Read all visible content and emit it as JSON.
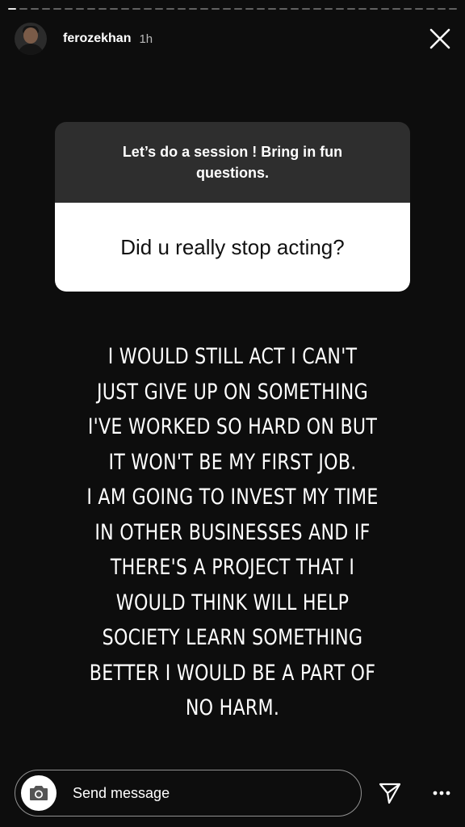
{
  "story": {
    "progress_segments": 40,
    "progress_completed": 1
  },
  "header": {
    "username": "ferozekhan",
    "time": "1h",
    "avatar_icon": "profile-photo",
    "close_icon": "close-icon"
  },
  "question_sticker": {
    "prompt": "Let’s do a session ! Bring in fun questions.",
    "question": "Did u really stop acting?"
  },
  "answer_text": "I WOULD STILL ACT I CAN'T\nJUST GIVE UP ON SOMETHING\nI'VE WORKED SO HARD ON BUT\nIT WON'T BE MY FIRST JOB.\nI AM GOING TO INVEST MY TIME\nIN OTHER BUSINESSES AND IF\nTHERE'S A PROJECT THAT I\nWOULD THINK WILL HELP\nSOCIETY LEARN SOMETHING\nBETTER I WOULD BE A PART OF\nNO HARM.",
  "footer": {
    "message_placeholder": "Send message",
    "camera_icon": "camera-icon",
    "send_icon": "send-icon",
    "more_icon": "more-options-icon"
  },
  "colors": {
    "background": "#0d0d0d",
    "sticker_top": "#2e2e2e",
    "sticker_bottom": "#ffffff"
  }
}
